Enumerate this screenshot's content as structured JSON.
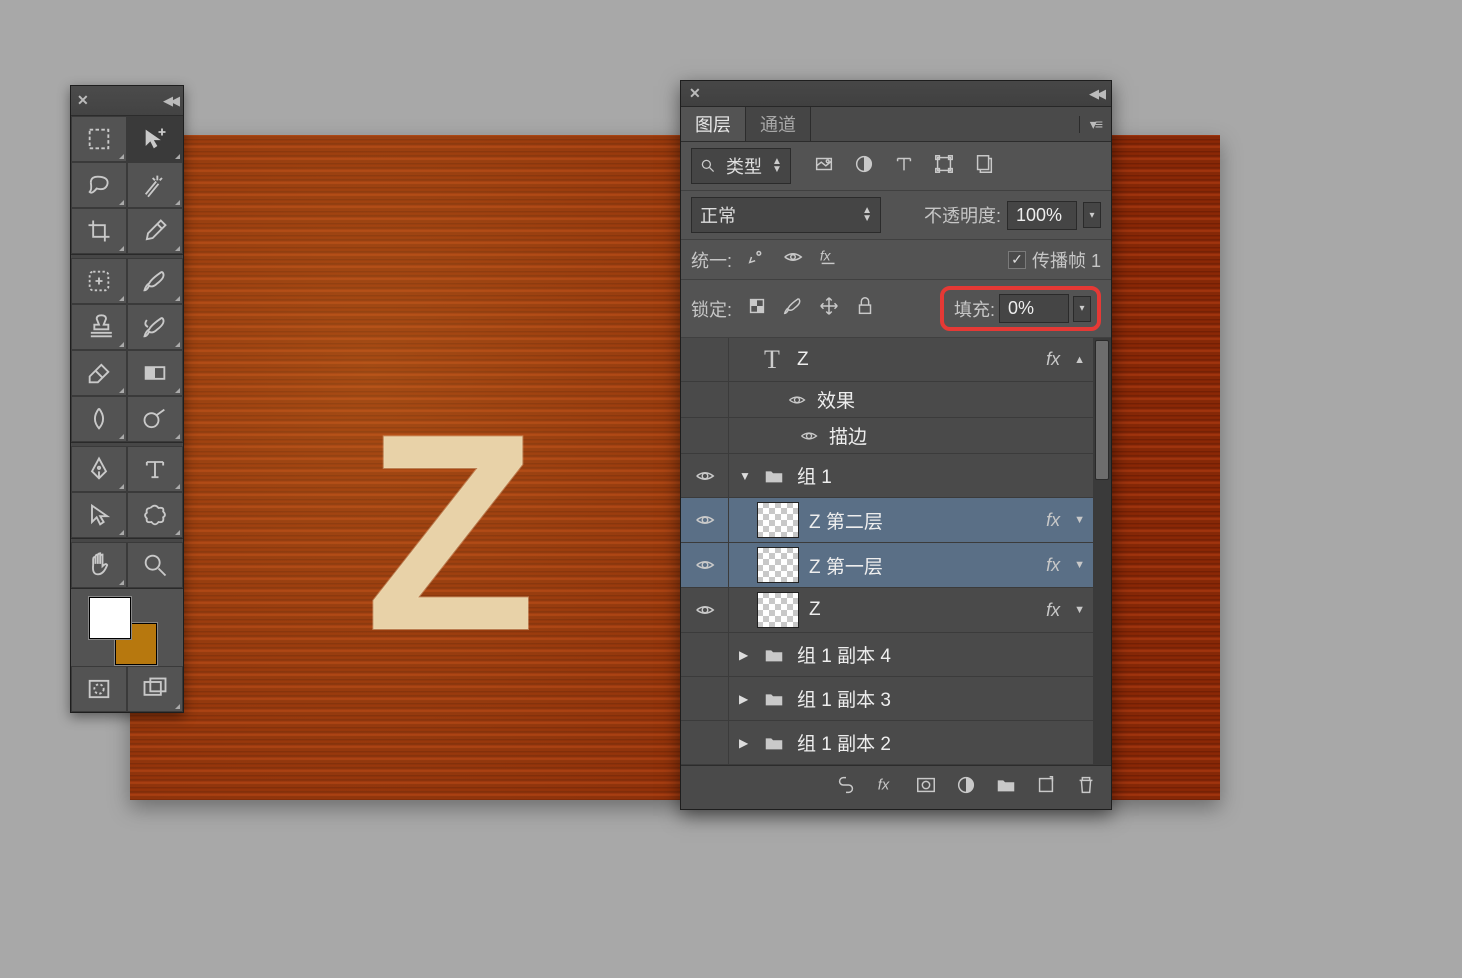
{
  "canvas": {
    "letter": "Z"
  },
  "layersPanel": {
    "tabs": {
      "layers": "图层",
      "channels": "通道"
    },
    "filterType": "类型",
    "blendMode": "正常",
    "opacityLabel": "不透明度:",
    "opacityValue": "100%",
    "unifyLabel": "统一:",
    "propagateLabel": "传播帧 1",
    "lockLabel": "锁定:",
    "fillLabel": "填充:",
    "fillValue": "0%",
    "fx": "fx",
    "layers": {
      "l0": "Z",
      "l0a": "效果",
      "l0b": "描边",
      "g1": "组 1",
      "g1a": "Z 第二层",
      "g1b": "Z 第一层",
      "g1c": "Z",
      "g2": "组 1 副本 4",
      "g3": "组 1 副本 3",
      "g4": "组 1 副本 2"
    }
  }
}
